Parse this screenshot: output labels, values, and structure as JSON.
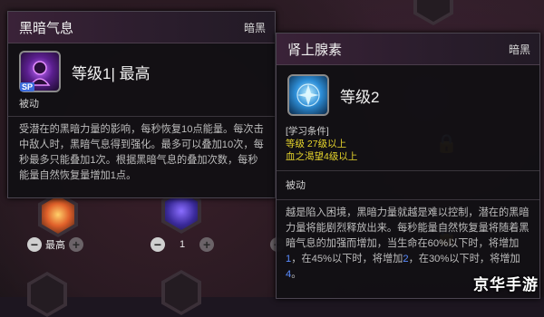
{
  "left_panel": {
    "title": "黑暗气息",
    "tag": "暗黑",
    "level_text": "等级1| 最高",
    "type_label": "被动",
    "description": "受潜在的黑暗力量的影响，每秒恢复10点能量。每次击中敌人时，黑暗气息得到强化。最多可以叠加10次，每秒最多只能叠加1次。根据黑暗气息的叠加次数，每秒能量自然恢复量增加1点。",
    "icon_badge": "SP"
  },
  "right_panel": {
    "title": "肾上腺素",
    "tag": "暗黑",
    "level_text": "等级2",
    "req_header": "[学习条件]",
    "req_1": "等级 27级以上",
    "req_2": "血之渴望4级以上",
    "type_label": "被动",
    "desc_part1": "越是陷入困境，黑暗力量就越是难以控制，潜在的黑暗力量将能剧烈释放出来。每秒能量自然恢复量将随着黑暗气息的加强而增加，当生命在60%以下时，将增加",
    "desc_num1": "1",
    "desc_part2": "，在45%以下时，将增加",
    "desc_num2": "2",
    "desc_part3": "，在30%以下时，将增加",
    "desc_num3": "4",
    "desc_part4": "。"
  },
  "skill_tree": {
    "node1_value": "最高",
    "node2_value": "1",
    "minus_symbol": "−",
    "plus_symbol": "+"
  },
  "watermark": "京华手游",
  "colors": {
    "requirement": "#e6d42c",
    "highlight_number": "#5a8cff"
  }
}
